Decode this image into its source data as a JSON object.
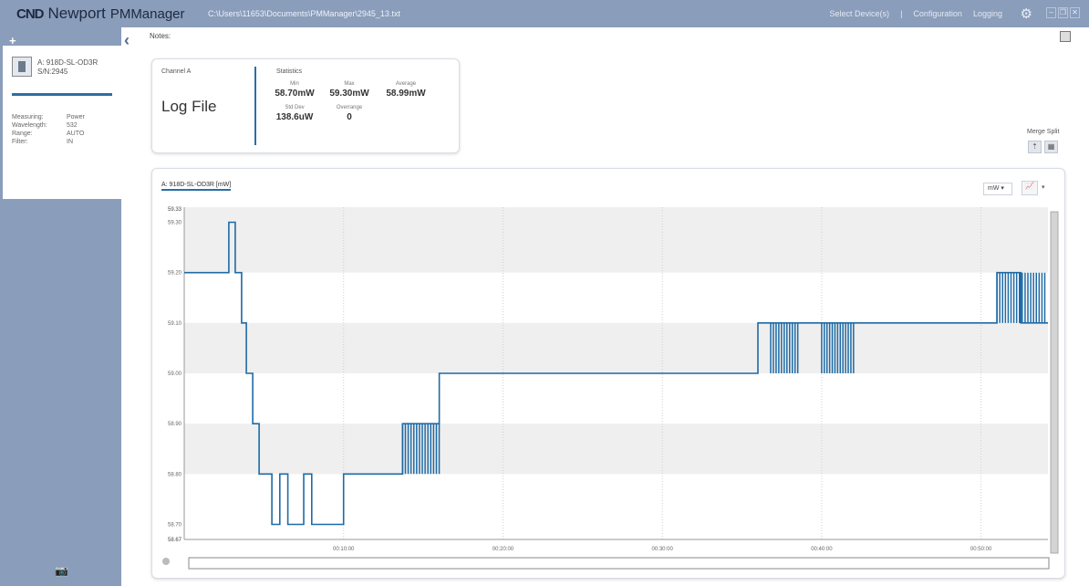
{
  "app": {
    "logo_mark": "CND",
    "brand": "Newport",
    "name": "PMManager",
    "file_path": "C:\\Users\\11653\\Documents\\PMManager\\2945_13.txt"
  },
  "menu": {
    "select_devices": "Select Device(s)",
    "configuration": "Configuration",
    "logging": "Logging"
  },
  "sidebar": {
    "device_name": "A: 918D-SL-OD3R",
    "device_serial": "S/N:2945",
    "properties": [
      {
        "key": "Measuring:",
        "value": "Power"
      },
      {
        "key": "Wavelength:",
        "value": "532"
      },
      {
        "key": "Range:",
        "value": "AUTO"
      },
      {
        "key": "Filter:",
        "value": "IN"
      }
    ]
  },
  "notes": {
    "label": "Notes:"
  },
  "stats": {
    "channel": "Channel A",
    "title": "Log File",
    "heading": "Statistics",
    "min_label": "Min",
    "min": "58.70mW",
    "max_label": "Max",
    "max": "59.30mW",
    "avg_label": "Average",
    "avg": "58.99mW",
    "std_label": "Std Dev",
    "std": "138.6uW",
    "over_label": "Overrange",
    "over": "0"
  },
  "view": {
    "merge_split": "Merge Split"
  },
  "chart": {
    "tab": "A: 918D-SL-OD3R [mW]",
    "unit": "mW"
  },
  "chart_data": {
    "type": "line",
    "series": [
      {
        "name": "A: 918D-SL-OD3R [mW]"
      }
    ],
    "y_labels": [
      "59.30",
      "59.20",
      "59.10",
      "59.00",
      "58.90",
      "58.80",
      "58.70"
    ],
    "y_top_label": "59.33",
    "y_bottom_label": "58.67",
    "ylim": [
      58.67,
      59.33
    ],
    "x_labels": [
      "00:10:00",
      "00:20:00",
      "00:30:00",
      "00:40:00",
      "00:50:00"
    ],
    "xlim_minutes": [
      0,
      54.2
    ],
    "x": [
      0.0,
      2.8,
      2.8,
      3.2,
      3.2,
      3.6,
      3.6,
      3.9,
      3.9,
      4.3,
      4.3,
      4.7,
      4.7,
      5.5,
      5.5,
      6.0,
      6.0,
      6.5,
      6.5,
      7.5,
      7.5,
      8.0,
      8.0,
      10.0,
      10.0,
      13.7,
      13.7,
      16.0,
      16.0,
      19.0,
      19.0,
      19.5,
      19.5,
      36.0,
      36.0,
      40.0,
      40.0,
      51.0,
      51.0,
      52.5,
      52.5,
      54.2
    ],
    "y": [
      59.2,
      59.2,
      59.3,
      59.3,
      59.2,
      59.2,
      59.1,
      59.1,
      59.0,
      59.0,
      58.9,
      58.9,
      58.8,
      58.8,
      58.7,
      58.7,
      58.8,
      58.8,
      58.7,
      58.7,
      58.8,
      58.8,
      58.7,
      58.7,
      58.8,
      58.8,
      58.9,
      58.9,
      59.0,
      59.0,
      59.0,
      59.0,
      59.0,
      59.0,
      59.1,
      59.1,
      59.1,
      59.1,
      59.2,
      59.2,
      59.1,
      59.1
    ],
    "noisy_bands": [
      {
        "x0": 13.7,
        "x1": 16.0,
        "y0": 58.8,
        "y1": 58.9
      },
      {
        "x0": 36.8,
        "x1": 38.5,
        "y0": 59.0,
        "y1": 59.1
      },
      {
        "x0": 40.0,
        "x1": 42.0,
        "y0": 59.0,
        "y1": 59.1
      },
      {
        "x0": 51.0,
        "x1": 54.0,
        "y0": 59.1,
        "y1": 59.2
      }
    ],
    "grid": true,
    "legend": "top-left",
    "color": "#1f6aa5"
  }
}
